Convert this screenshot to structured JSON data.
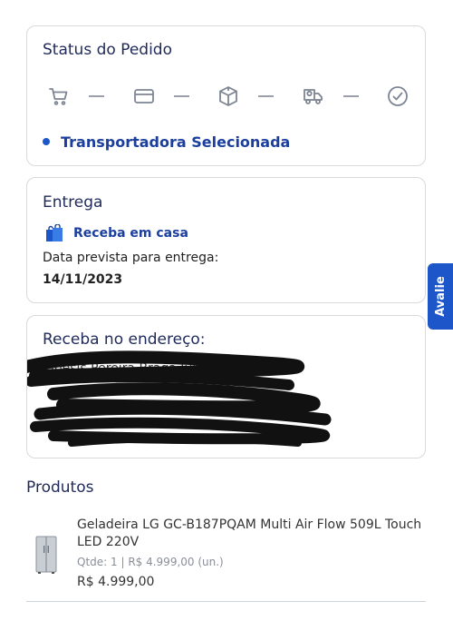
{
  "status": {
    "title": "Status do Pedido",
    "steps": [
      {
        "icon": "cart-icon",
        "state": "done"
      },
      {
        "icon": "credit-card-icon",
        "state": "done"
      },
      {
        "icon": "package-icon",
        "state": "done"
      },
      {
        "icon": "delivery-truck-icon",
        "state": "done"
      },
      {
        "icon": "check-circle-icon",
        "state": "pending"
      }
    ],
    "current": "Transportadora Selecionada"
  },
  "entrega": {
    "title": "Entrega",
    "method": "Receba em casa",
    "date_label": "Data prevista para entrega:",
    "date_value": "14/11/2023"
  },
  "endereco": {
    "title": "Receba no endereço:",
    "name_partial": "Elbesis Pereira Braga Junior"
  },
  "side_tab": {
    "label": "Avalie"
  },
  "produtos": {
    "title": "Produtos",
    "items": [
      {
        "name": "Geladeira LG GC-B187PQAM Multi Air Flow 509L Touch LED 220V",
        "qty_line": "Qtde: 1 | R$ 4.999,00 (un.)",
        "price": "R$ 4.999,00"
      }
    ]
  },
  "colors": {
    "accent": "#1c56c8",
    "heading": "#1f2a5a",
    "link": "#1c3f9e"
  }
}
